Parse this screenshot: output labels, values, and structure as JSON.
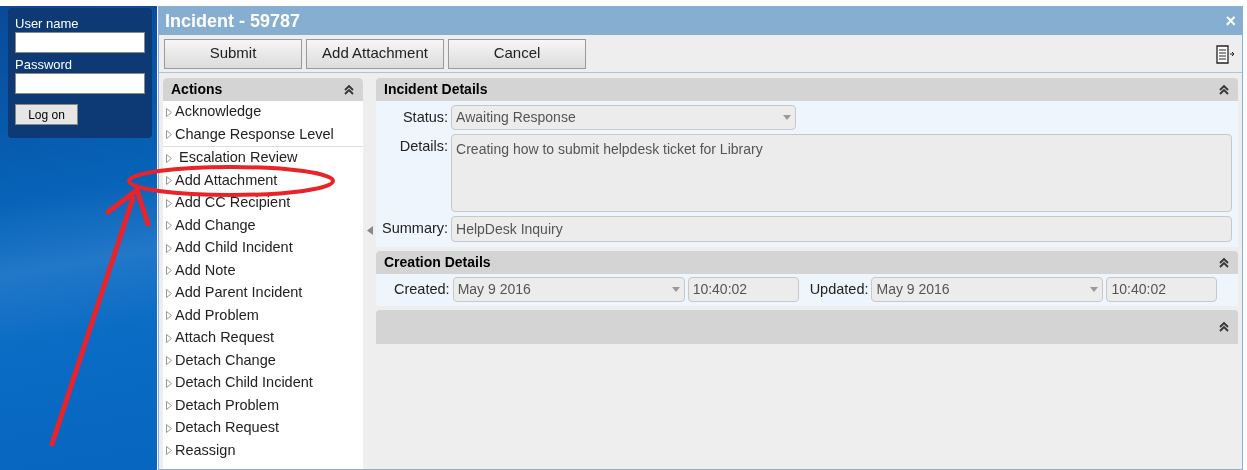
{
  "login": {
    "username_label": "User name",
    "password_label": "Password",
    "button": "Log on"
  },
  "window": {
    "title": "Incident - 59787",
    "close": "×"
  },
  "toolbar": {
    "buttons": [
      "Submit",
      "Add Attachment",
      "Cancel"
    ]
  },
  "actions": {
    "title": "Actions",
    "groups": [
      [
        "Acknowledge",
        "Change Response Level"
      ],
      [
        " Escalation Review",
        "Add Attachment",
        "Add CC Recipient",
        "Add Change",
        "Add Child Incident",
        "Add Note",
        "Add Parent Incident",
        "Add Problem",
        "Attach Request",
        "Detach Change",
        "Detach Child Incident",
        "Detach Problem",
        "Detach Request",
        "Reassign"
      ]
    ]
  },
  "incident_details": {
    "title": "Incident Details",
    "status_label": "Status:",
    "status": "Awaiting Response",
    "details_label": "Details:",
    "details": "Creating how to submit helpdesk ticket for Library",
    "summary_label": "Summary:",
    "summary": "HelpDesk Inquiry"
  },
  "creation_details": {
    "title": "Creation Details",
    "created_label": "Created:",
    "created_date": "May 9 2016",
    "created_time": "10:40:02",
    "updated_label": "Updated:",
    "updated_date": "May 9 2016",
    "updated_time": "10:40:02"
  }
}
